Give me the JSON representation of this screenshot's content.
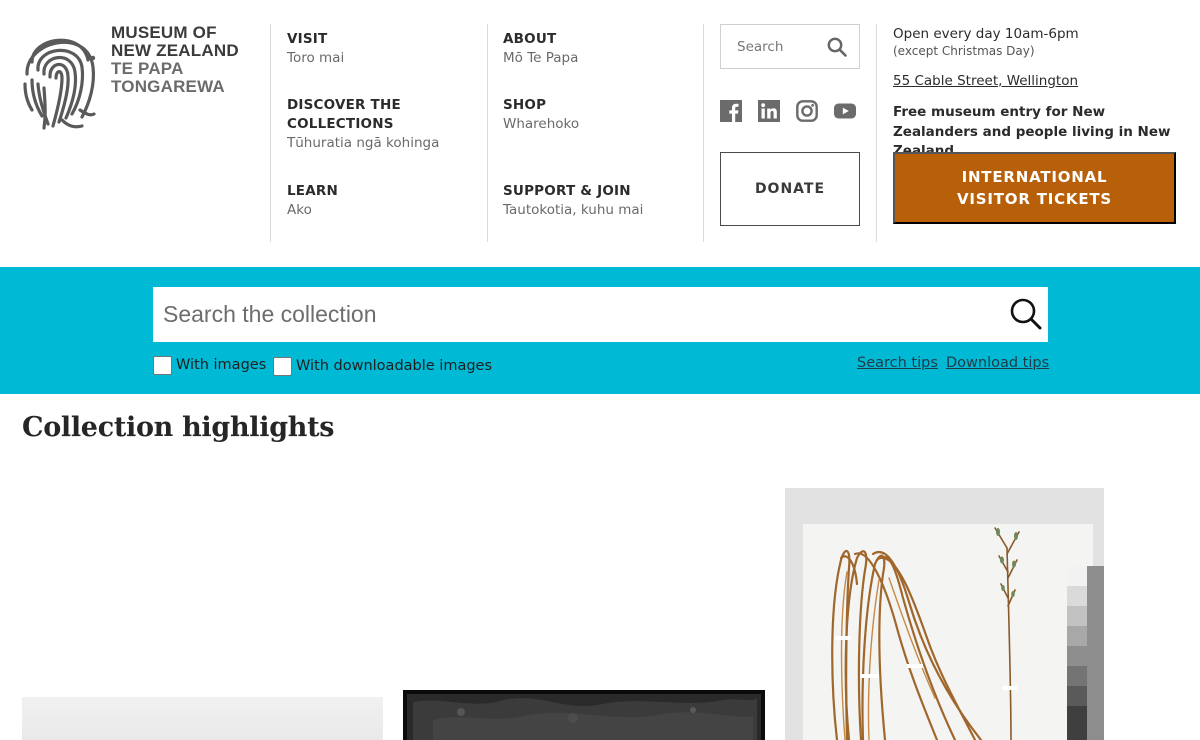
{
  "logo": {
    "line1": "MUSEUM OF",
    "line2": "NEW ZEALAND",
    "line3": "TE PAPA",
    "line4": "TONGAREWA"
  },
  "nav": [
    {
      "title": "VISIT",
      "subtitle": "Toro mai"
    },
    {
      "title": "DISCOVER THE COLLECTIONS",
      "subtitle": "Tūhuratia ngā kohinga"
    },
    {
      "title": "LEARN",
      "subtitle": "Ako"
    },
    {
      "title": "ABOUT",
      "subtitle": "Mō Te Papa"
    },
    {
      "title": "SHOP",
      "subtitle": "Wharehoko"
    },
    {
      "title": "SUPPORT & JOIN",
      "subtitle": "Tautokotia, kuhu mai"
    }
  ],
  "header_search": {
    "placeholder": "Search"
  },
  "social": [
    "facebook-icon",
    "linkedin-icon",
    "instagram-icon",
    "youtube-icon"
  ],
  "donate_label": "DONATE",
  "info": {
    "hours": "Open every day 10am-6pm",
    "except": "(except Christmas Day)",
    "address": "55 Cable Street, Wellington",
    "free_entry": "Free museum entry for New Zealanders and people living in New Zealand"
  },
  "tickets_label": "INTERNATIONAL VISITOR TICKETS",
  "collection_search": {
    "placeholder": "Search the collection",
    "with_images": "With images",
    "with_downloadable": "With downloadable images",
    "search_tips": "Search tips",
    "download_tips": "Download tips"
  },
  "highlights_title": "Collection highlights",
  "colors": {
    "band": "#00b9d4",
    "tickets": "#b85f0a"
  }
}
